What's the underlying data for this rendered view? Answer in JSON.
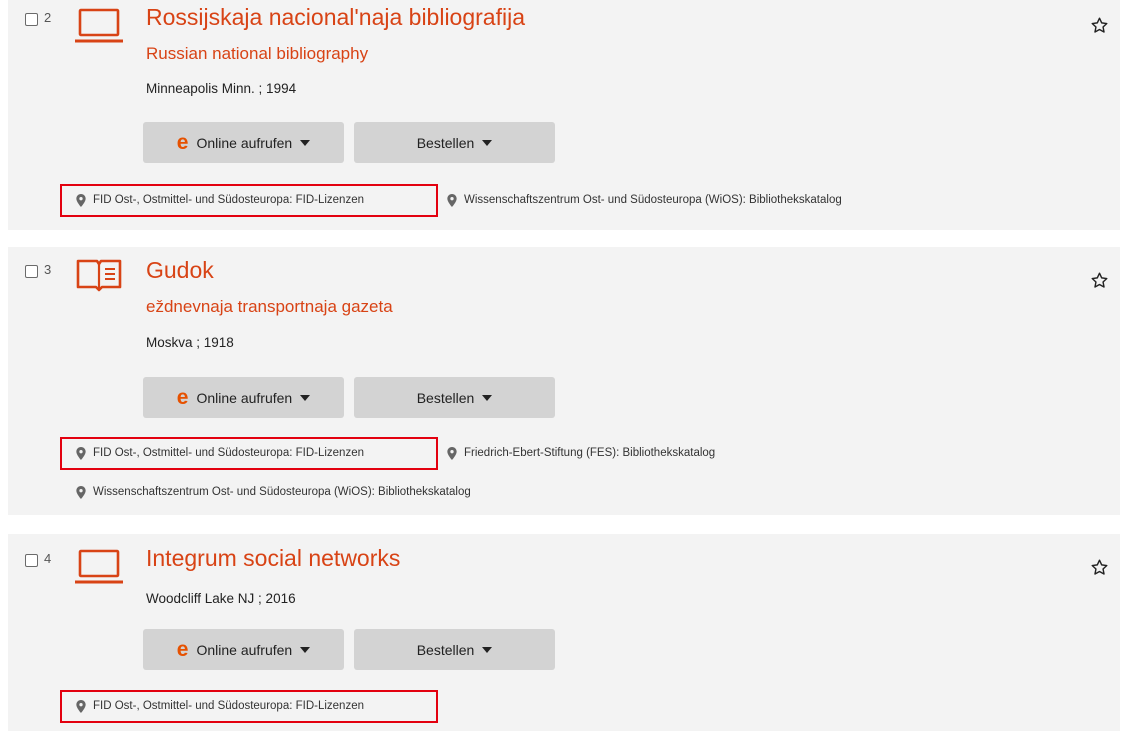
{
  "results": [
    {
      "number": "2",
      "type_icon": "laptop-icon",
      "title": "Rossijskaja nacional'naja bibliografija",
      "subtitle": "Russian national bibliography",
      "publication": "Minneapolis Minn. ; 1994",
      "online_button": "Online aufrufen",
      "order_button": "Bestellen",
      "locations": [
        "FID Ost-, Ostmittel- und Südosteuropa: FID-Lizenzen",
        "Wissenschaftszentrum Ost- und Südosteuropa (WiOS): Bibliothekskatalog"
      ]
    },
    {
      "number": "3",
      "type_icon": "open-book-icon",
      "title": "Gudok",
      "subtitle": "eždnevnaja transportnaja gazeta",
      "publication": "Moskva ; 1918",
      "online_button": "Online aufrufen",
      "order_button": "Bestellen",
      "locations": [
        "FID Ost-, Ostmittel- und Südosteuropa: FID-Lizenzen",
        "Friedrich-Ebert-Stiftung (FES): Bibliothekskatalog",
        "Wissenschaftszentrum Ost- und Südosteuropa (WiOS): Bibliothekskatalog"
      ]
    },
    {
      "number": "4",
      "type_icon": "laptop-icon",
      "title": "Integrum social networks",
      "publication": "Woodcliff Lake NJ ; 2016",
      "online_button": "Online aufrufen",
      "order_button": "Bestellen",
      "locations": [
        "FID Ost-, Ostmittel- und Südosteuropa: FID-Lizenzen"
      ]
    }
  ],
  "colors": {
    "accent": "#d84315",
    "e_icon": "#e65100",
    "highlight_border": "#e3000f",
    "card_background": "#f3f3f3",
    "button_background": "#d3d3d3"
  }
}
